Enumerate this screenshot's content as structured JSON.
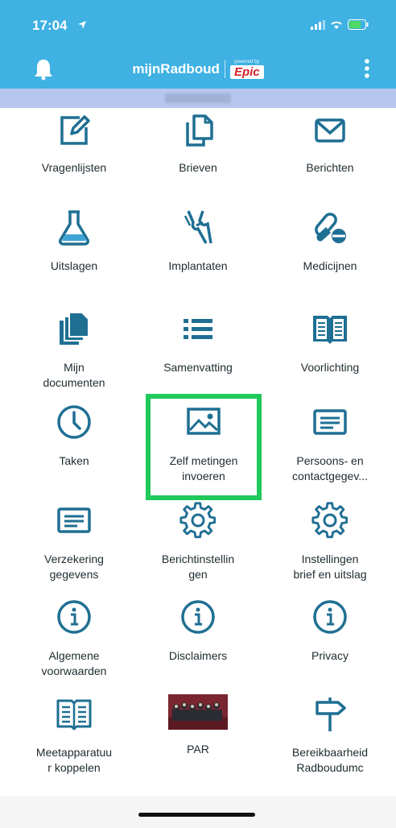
{
  "status": {
    "time": "17:04"
  },
  "header": {
    "app_name": "mijnRadboud",
    "powered_by": "powered by",
    "epic": "Epic"
  },
  "tiles": [
    {
      "label": "Vragenlijsten",
      "icon": "edit-icon"
    },
    {
      "label": "Brieven",
      "icon": "documents-icon"
    },
    {
      "label": "Berichten",
      "icon": "mail-icon"
    },
    {
      "label": "Uitslagen",
      "icon": "flask-icon"
    },
    {
      "label": "Implantaten",
      "icon": "joint-icon"
    },
    {
      "label": "Medicijnen",
      "icon": "pill-icon"
    },
    {
      "label": "Mijn\ndocumenten",
      "icon": "files-icon"
    },
    {
      "label": "Samenvatting",
      "icon": "list-icon"
    },
    {
      "label": "Voorlichting",
      "icon": "book-icon"
    },
    {
      "label": "Taken",
      "icon": "clock-icon"
    },
    {
      "label": "Zelf metingen\ninvoeren",
      "icon": "image-icon"
    },
    {
      "label": "Persoons- en\ncontactgegev...",
      "icon": "card-icon"
    },
    {
      "label": "Verzekering\ngegevens",
      "icon": "card-icon"
    },
    {
      "label": "Berichtinstellin\ngen",
      "icon": "gear-icon"
    },
    {
      "label": "Instellingen\nbrief en uitslag",
      "icon": "gear-icon"
    },
    {
      "label": "Algemene\nvoorwaarden",
      "icon": "info-icon"
    },
    {
      "label": "Disclaimers",
      "icon": "info-icon"
    },
    {
      "label": "Privacy",
      "icon": "info-icon"
    },
    {
      "label": "Meetapparatuu\nr koppelen",
      "icon": "book-outline-icon"
    },
    {
      "label": "PAR",
      "icon": "photo-thumbnail"
    },
    {
      "label": "Bereikbaarheid\nRadboudumc",
      "icon": "signpost-icon"
    }
  ],
  "colors": {
    "header": "#3fb1e3",
    "icon": "#1f6f93",
    "highlight": "#1fc95b"
  }
}
